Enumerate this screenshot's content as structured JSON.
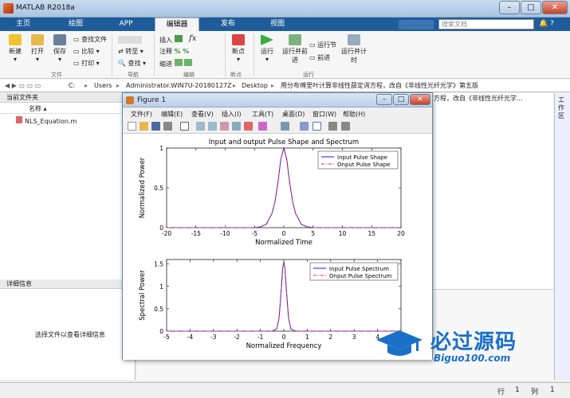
{
  "window": {
    "title": "MATLAB R2018a"
  },
  "tabs": [
    "主页",
    "绘图",
    "APP",
    "编辑器",
    "发布",
    "视图"
  ],
  "search_placeholder": "搜索文档",
  "ribbon": {
    "file_group": {
      "label": "文件",
      "new": "新建",
      "open": "打开",
      "save": "保存",
      "find_files": "查找文件",
      "compare": "比较",
      "print": "打印"
    },
    "nav_group": {
      "label": "导航",
      "goto": "转至",
      "find": "查找"
    },
    "edit_group": {
      "label": "编辑",
      "insert": "插入",
      "comment": "注释",
      "indent": "缩进",
      "fx": "fx"
    },
    "breakpoints_group": {
      "label": "断点",
      "breakpoints": "断点"
    },
    "run_group": {
      "label": "运行",
      "run": "运行",
      "run_advance": "运行并前进",
      "run_section": "运行节",
      "advance": "前进",
      "run_time": "运行并计时"
    }
  },
  "address": {
    "parts": [
      "C:",
      "Users",
      "Administrator.WIN7U-20180127Z",
      "Desktop",
      "用分布傅里叶计算非线性薛定谔方程，改自《非线性光纤光学》第五版"
    ]
  },
  "current_folder": {
    "title": "当前文件夹",
    "column_name": "名称",
    "files": [
      "NLS_Equation.m"
    ]
  },
  "details": {
    "title": "详细信息",
    "hint": "选择文件以查看详细信息"
  },
  "right_strip_label": "工作区",
  "editor_tab_text": "方程，改自《非线性光纤光学...",
  "status": {
    "row_label": "行",
    "row": "1",
    "col_label": "列",
    "col": "1"
  },
  "figure": {
    "title": "Figure 1",
    "menu": [
      "文件(F)",
      "编辑(E)",
      "查看(V)",
      "插入(I)",
      "工具(T)",
      "桌面(D)",
      "窗口(W)",
      "帮助(H)"
    ]
  },
  "watermark": {
    "text": "必过源码",
    "sub": "Biguo100.com"
  },
  "chart_data": [
    {
      "type": "line",
      "title": "Input and output Pulse Shape and Spectrum",
      "xlabel": "Normalized Time",
      "ylabel": "Normalized Power",
      "xlim": [
        -20,
        20
      ],
      "ylim": [
        0,
        1
      ],
      "xticks": [
        -20,
        -15,
        -10,
        -5,
        0,
        5,
        10,
        15,
        20
      ],
      "yticks": [
        0,
        0.5,
        1
      ],
      "legend_position": "top-right",
      "x": [
        -20,
        -5,
        -4,
        -3,
        -2,
        -1.5,
        -1,
        -0.5,
        0,
        0.5,
        1,
        1.5,
        2,
        3,
        4,
        5,
        20
      ],
      "series": [
        {
          "name": "Input Pulse Shape",
          "color": "#1a1aff",
          "style": "solid",
          "values": [
            0,
            0.0,
            0.01,
            0.04,
            0.18,
            0.33,
            0.57,
            0.86,
            1.0,
            0.86,
            0.57,
            0.33,
            0.18,
            0.04,
            0.01,
            0.0,
            0
          ]
        },
        {
          "name": "Onput Pulse Shape",
          "color": "#e0304a",
          "style": "dashdot",
          "values": [
            0,
            0.0,
            0.01,
            0.04,
            0.18,
            0.33,
            0.57,
            0.86,
            1.0,
            0.86,
            0.57,
            0.33,
            0.18,
            0.04,
            0.01,
            0.0,
            0
          ]
        }
      ]
    },
    {
      "type": "line",
      "xlabel": "Normalized Frequency",
      "ylabel": "Spectral Power",
      "xlim": [
        -5,
        5
      ],
      "ylim": [
        0,
        1.6
      ],
      "xticks": [
        -5,
        -4,
        -3,
        -2,
        -1,
        0,
        1,
        2,
        3,
        4,
        5
      ],
      "yticks": [
        0,
        0.5,
        1,
        1.5
      ],
      "legend_position": "top-right",
      "x": [
        -5,
        -0.5,
        -0.3,
        -0.2,
        -0.1,
        -0.05,
        0,
        0.05,
        0.1,
        0.2,
        0.3,
        0.5,
        5
      ],
      "series": [
        {
          "name": "Input Pulse Spectrum",
          "color": "#1a1aff",
          "style": "solid",
          "values": [
            0,
            0.0,
            0.05,
            0.3,
            1.0,
            1.4,
            1.55,
            1.4,
            1.0,
            0.3,
            0.05,
            0.0,
            0
          ]
        },
        {
          "name": "Onput Pulse Spectrum",
          "color": "#e0304a",
          "style": "dashdot",
          "values": [
            0,
            0.0,
            0.05,
            0.3,
            1.0,
            1.4,
            1.55,
            1.4,
            1.0,
            0.3,
            0.05,
            0.0,
            0
          ]
        }
      ]
    }
  ]
}
